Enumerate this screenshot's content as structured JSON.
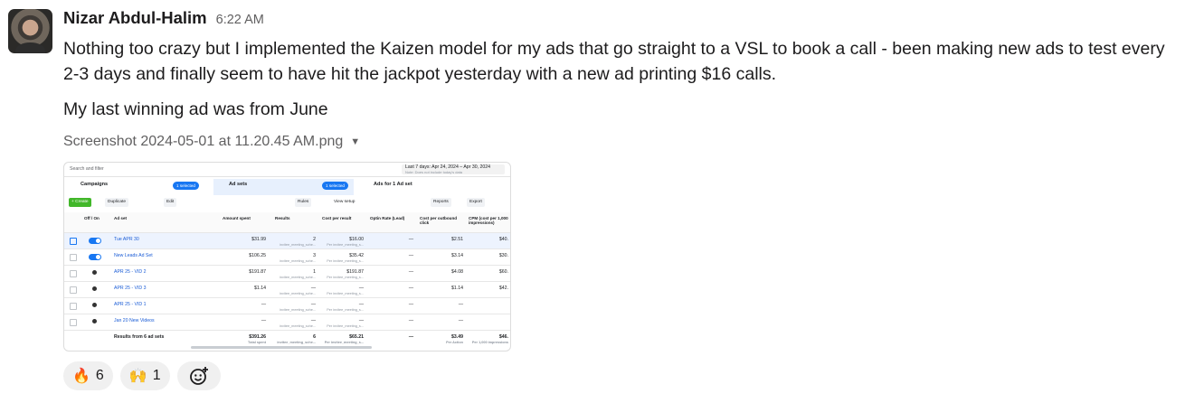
{
  "message": {
    "sender": "Nizar Abdul-Halim",
    "time": "6:22 AM",
    "paragraph1": "Nothing too crazy but I implemented the Kaizen model for my ads that go straight to a VSL to book a call - been making new ads to test every 2-3 days and finally seem to have hit the jackpot yesterday with a new ad printing $16 calls.",
    "paragraph2": "My last winning ad was from June",
    "attachment_name": "Screenshot 2024-05-01 at 11.20.45 AM.png"
  },
  "screenshot": {
    "search_placeholder": "Search and filter",
    "date_range": "Last 7 days: Apr 24, 2024 – Apr 30, 2024",
    "date_note": "Note: Does not include today's data",
    "tab_campaigns": "Campaigns",
    "tab_campaigns_badge": "1 selected",
    "tab_adsets": "Ad sets",
    "tab_adsets_badge": "1 selected",
    "tab_ads": "Ads for 1 Ad set",
    "toolbar": {
      "create": "+ Create",
      "duplicate": "Duplicate",
      "edit": "Edit",
      "rules": "Rules",
      "view_setup": "View setup",
      "reports": "Reports",
      "export": "Export"
    },
    "headers": [
      "Off / On",
      "Ad set",
      "Amount spent",
      "Results",
      "Cost per result",
      "Optin Rate (Lead)",
      "Cost per outbound click",
      "CPM (cost per 1,000 impressions)"
    ],
    "rows": [
      {
        "name": "Tue APR 30",
        "spent": "$31.99",
        "results": "2",
        "results_sub": "invitee_meeting_sche...",
        "cpr": "$16.00",
        "cpr_sub": "Per invitee_meeting_s...",
        "optin": "—",
        "cpoc": "$2.51",
        "cpm": "$40."
      },
      {
        "name": "New Leads Ad Set",
        "spent": "$106.25",
        "results": "3",
        "results_sub": "invitee_meeting_sche...",
        "cpr": "$35.42",
        "cpr_sub": "Per invitee_meeting_s...",
        "optin": "—",
        "cpoc": "$3.14",
        "cpm": "$30."
      },
      {
        "name": "APR 25 - VID 2",
        "spent": "$191.87",
        "results": "1",
        "results_sub": "invitee_meeting_sche...",
        "cpr": "$191.87",
        "cpr_sub": "Per invitee_meeting_s...",
        "optin": "—",
        "cpoc": "$4.08",
        "cpm": "$60."
      },
      {
        "name": "APR 25 - VID 3",
        "spent": "$1.14",
        "results": "—",
        "results_sub": "invitee_meeting_sche...",
        "cpr": "—",
        "cpr_sub": "Per invitee_meeting_s...",
        "optin": "—",
        "cpoc": "$1.14",
        "cpm": "$42."
      },
      {
        "name": "APR 25 - VID 1",
        "spent": "—",
        "results": "—",
        "results_sub": "invitee_meeting_sche...",
        "cpr": "—",
        "cpr_sub": "Per invitee_meeting_s...",
        "optin": "—",
        "cpoc": "—",
        "cpm": ""
      },
      {
        "name": "Jan 20 New Videos",
        "spent": "—",
        "results": "—",
        "results_sub": "invitee_meeting_sche...",
        "cpr": "—",
        "cpr_sub": "Per invitee_meeting_s...",
        "optin": "—",
        "cpoc": "—",
        "cpm": ""
      }
    ],
    "footer": {
      "label": "Results from 6 ad sets",
      "spent": "$391.26",
      "spent_sub": "Total spent",
      "results": "6",
      "results_sub": "invitee_meeting_sche...",
      "cpr": "$65.21",
      "cpr_sub": "Per invitee_meeting_s...",
      "optin": "—",
      "cpoc": "$3.49",
      "cpoc_sub": "Per Action",
      "cpm": "$46.",
      "cpm_sub": "Per 1,000 impressions"
    }
  },
  "reactions": [
    {
      "emoji": "🔥",
      "count": "6"
    },
    {
      "emoji": "🙌",
      "count": "1"
    }
  ]
}
